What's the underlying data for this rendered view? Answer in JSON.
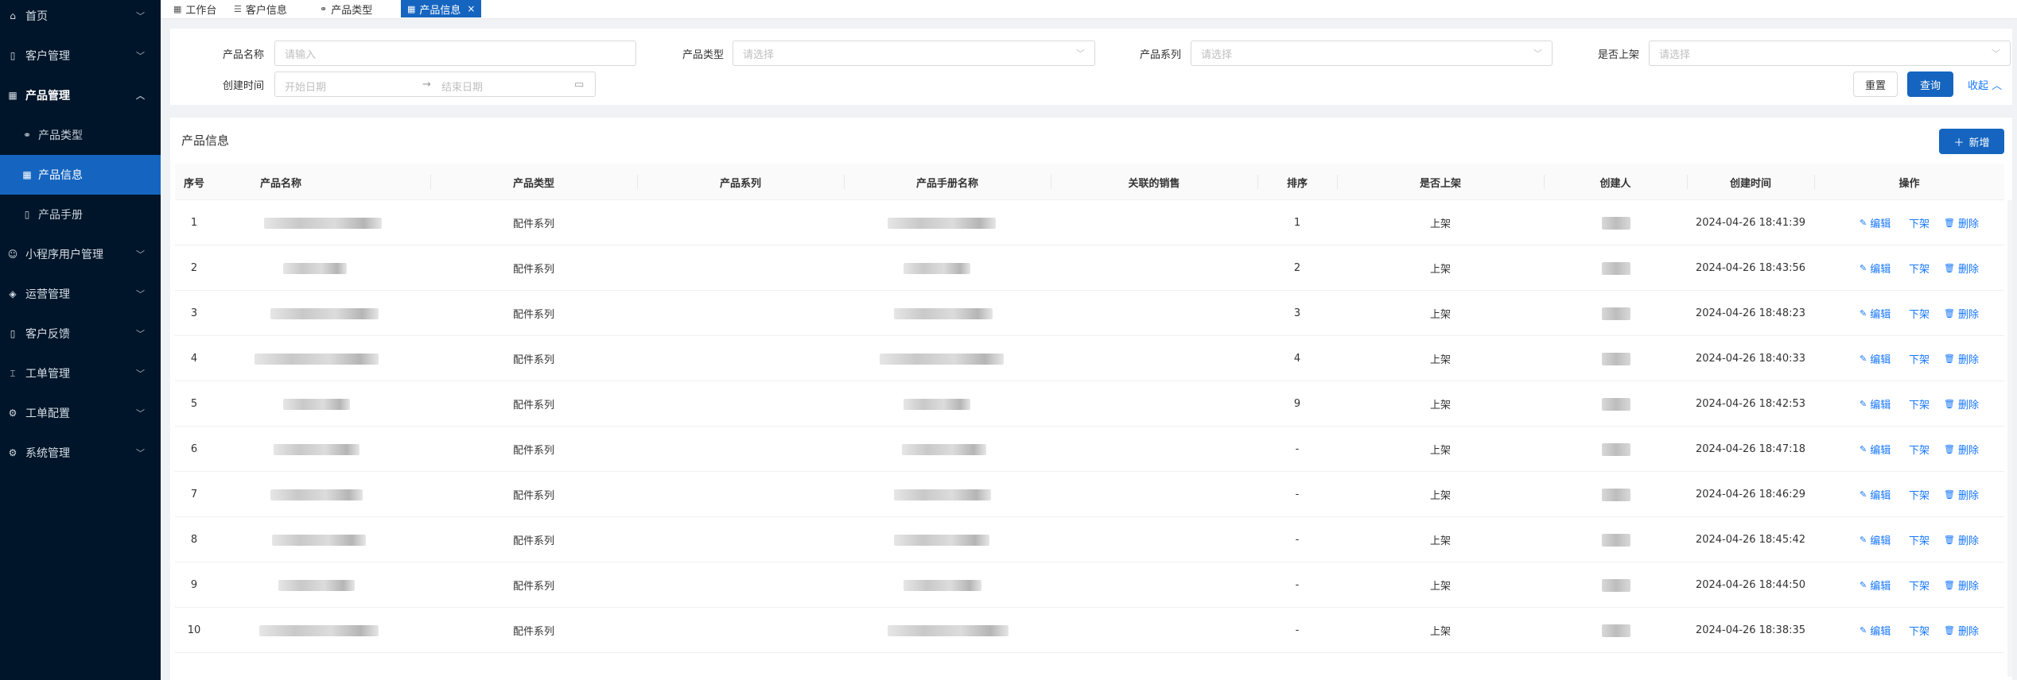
{
  "sidebar": {
    "items": [
      {
        "label": "首页",
        "icon": "home-icon"
      },
      {
        "label": "客户管理",
        "icon": "customer-icon"
      },
      {
        "label": "产品管理",
        "icon": "product-icon"
      },
      {
        "label": "小程序用户管理",
        "icon": "users-icon"
      },
      {
        "label": "运营管理",
        "icon": "operation-icon"
      },
      {
        "label": "客户反馈",
        "icon": "feedback-icon"
      },
      {
        "label": "工单管理",
        "icon": "ticket-icon"
      },
      {
        "label": "工单配置",
        "icon": "config-icon"
      },
      {
        "label": "系统管理",
        "icon": "gear-icon"
      }
    ],
    "product_sub": [
      {
        "label": "产品类型"
      },
      {
        "label": "产品信息"
      },
      {
        "label": "产品手册"
      }
    ]
  },
  "tabs": [
    {
      "label": "工作台"
    },
    {
      "label": "客户信息"
    },
    {
      "label": "产品类型"
    },
    {
      "label": "产品信息"
    }
  ],
  "filter": {
    "name_label": "产品名称",
    "name_placeholder": "请输入",
    "type_label": "产品类型",
    "type_placeholder": "请选择",
    "series_label": "产品系列",
    "series_placeholder": "请选择",
    "listed_label": "是否上架",
    "listed_placeholder": "请选择",
    "created_label": "创建时间",
    "start_placeholder": "开始日期",
    "end_placeholder": "结束日期",
    "reset_label": "重置",
    "query_label": "查询",
    "collapse_label": "收起"
  },
  "table": {
    "title": "产品信息",
    "add_label": "新增",
    "columns": [
      "序号",
      "产品名称",
      "产品类型",
      "产品系列",
      "产品手册名称",
      "关联的销售",
      "排序",
      "是否上架",
      "创建人",
      "创建时间",
      "操作"
    ],
    "actions": {
      "edit": "编辑",
      "offline": "下架",
      "delete": "删除"
    },
    "rows": [
      {
        "no": "1",
        "type": "配件系列",
        "sort": "1",
        "listed": "上架",
        "created": "2024-04-26 18:41:39"
      },
      {
        "no": "2",
        "type": "配件系列",
        "sort": "2",
        "listed": "上架",
        "created": "2024-04-26 18:43:56"
      },
      {
        "no": "3",
        "type": "配件系列",
        "sort": "3",
        "listed": "上架",
        "created": "2024-04-26 18:48:23"
      },
      {
        "no": "4",
        "type": "配件系列",
        "sort": "4",
        "listed": "上架",
        "created": "2024-04-26 18:40:33"
      },
      {
        "no": "5",
        "type": "配件系列",
        "sort": "9",
        "listed": "上架",
        "created": "2024-04-26 18:42:53"
      },
      {
        "no": "6",
        "type": "配件系列",
        "sort": "-",
        "listed": "上架",
        "created": "2024-04-26 18:47:18"
      },
      {
        "no": "7",
        "type": "配件系列",
        "sort": "-",
        "listed": "上架",
        "created": "2024-04-26 18:46:29"
      },
      {
        "no": "8",
        "type": "配件系列",
        "sort": "-",
        "listed": "上架",
        "created": "2024-04-26 18:45:42"
      },
      {
        "no": "9",
        "type": "配件系列",
        "sort": "-",
        "listed": "上架",
        "created": "2024-04-26 18:44:50"
      },
      {
        "no": "10",
        "type": "配件系列",
        "sort": "-",
        "listed": "上架",
        "created": "2024-04-26 18:38:35"
      }
    ]
  },
  "colors": {
    "primary": "#1565c0",
    "sidebar_bg": "#001529",
    "link": "#1677ff"
  }
}
